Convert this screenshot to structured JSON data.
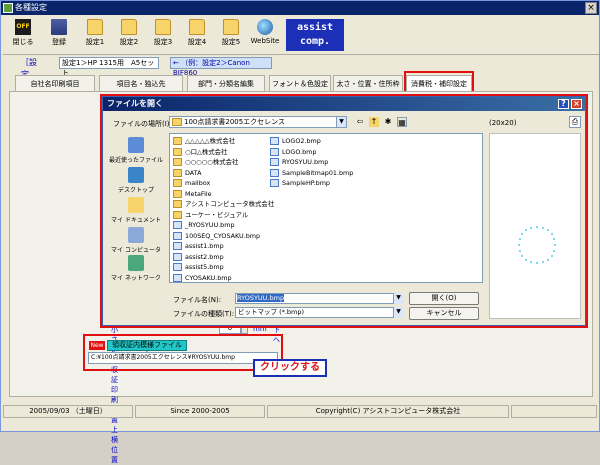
{
  "window": {
    "title": "各種設定",
    "close": "×"
  },
  "toolbar": [
    {
      "label": "閉じる",
      "icon": "off-icon",
      "glyph": "OFF"
    },
    {
      "label": "登録",
      "icon": "register-icon"
    },
    {
      "label": "設定1",
      "icon": "folder-icon"
    },
    {
      "label": "設定2",
      "icon": "folder-icon"
    },
    {
      "label": "設定3",
      "icon": "folder-icon"
    },
    {
      "label": "設定4",
      "icon": "folder-icon"
    },
    {
      "label": "設定5",
      "icon": "folder-icon"
    },
    {
      "label": "WebSite",
      "icon": "website-icon"
    }
  ],
  "assist": {
    "line1": "assist",
    "line2": "comp."
  },
  "settings": {
    "label": "［設定名］",
    "value": "設定1＞HP 1315用　A5セット",
    "hint": "← （例：設定2＞Canon BJF860"
  },
  "tabs": [
    "自社名印刷項目",
    "項目名・独込先",
    "部門・分類名編集",
    "フォント＆色設定",
    "太さ・位置・住所枠他",
    "消費税・補印設定"
  ],
  "dialog": {
    "title": "ファイルを開く",
    "help": "?",
    "close": "×",
    "look_in_label": "ファイルの場所(I):",
    "look_in_value": "100点請求書2005エクセレンス",
    "preview_size": "(20x20)",
    "places": [
      "最近使ったファイル",
      "デスクトップ",
      "マイ ドキュメント",
      "マイ コンピュータ",
      "マイ ネットワーク"
    ],
    "files_col1": [
      {
        "name": "△△△△△株式会社",
        "type": "folder"
      },
      {
        "name": "○口△株式会社",
        "type": "folder"
      },
      {
        "name": "○○○○○株式会社",
        "type": "folder"
      },
      {
        "name": "DATA",
        "type": "folder"
      },
      {
        "name": "mailbox",
        "type": "folder"
      },
      {
        "name": "MetaFile",
        "type": "folder"
      },
      {
        "name": "アシストコンピュータ株式会社",
        "type": "folder"
      },
      {
        "name": "ユーケー・ビジュアル",
        "type": "folder"
      },
      {
        "name": "_RYOSYUU.bmp",
        "type": "file"
      },
      {
        "name": "100SEQ_CYOSAKU.bmp",
        "type": "file"
      },
      {
        "name": "assist1.bmp",
        "type": "file"
      },
      {
        "name": "assist2.bmp",
        "type": "file"
      },
      {
        "name": "assist5.bmp",
        "type": "file"
      },
      {
        "name": "CYOSAKU.bmp",
        "type": "file"
      }
    ],
    "files_col2": [
      {
        "name": "LOGO2.bmp",
        "type": "file"
      },
      {
        "name": "LOGO.bmp",
        "type": "file"
      },
      {
        "name": "RYOSYUU.bmp",
        "type": "file"
      },
      {
        "name": "SampleBitmap01.bmp",
        "type": "file"
      },
      {
        "name": "SampleHP.bmp",
        "type": "file"
      }
    ],
    "filename_label": "ファイル名(N):",
    "filename_value": "RYOSYUU.bmp",
    "filetype_label": "ファイルの種類(T):",
    "filetype_value": "ビットマップ (*.bmp)",
    "open_button": "開く(O)",
    "cancel_button": "キャンセル"
  },
  "position": {
    "label": "小さい領収証印刷位置上横位置",
    "value": "0",
    "unit": "mm",
    "down": "下へ"
  },
  "receipt": {
    "new_badge": "New",
    "file_button": "領収証内模様ファイル ↓",
    "path": "C:¥100点請求書2005エクセレンス¥RYOSYUU.bmp",
    "click_label": "クリックする"
  },
  "status": {
    "date": "2005/09/03 （土曜日）",
    "since": "Since 2000-2005",
    "copyright": "Copyright(C) アシストコンピュータ株式会社"
  },
  "colors": {
    "accent_red": "#e01010",
    "assist_blue": "#1c2fb7",
    "title_blue": "#0a246a"
  }
}
